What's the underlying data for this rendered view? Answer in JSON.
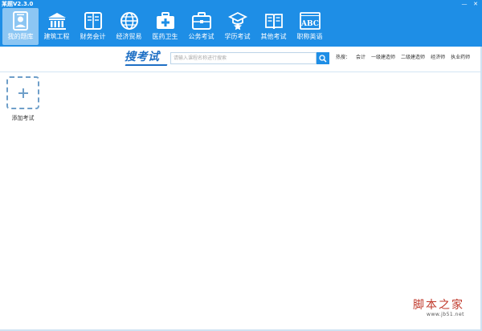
{
  "window": {
    "title": "某题V2.3.0",
    "minimize": "—",
    "close": "✕"
  },
  "nav": {
    "items": [
      {
        "label": "我的题库",
        "icon": "question-bank-icon",
        "active": true
      },
      {
        "label": "建筑工程",
        "icon": "building-icon"
      },
      {
        "label": "财务会计",
        "icon": "book-icon"
      },
      {
        "label": "经济贸易",
        "icon": "globe-icon"
      },
      {
        "label": "医药卫生",
        "icon": "medical-kit-icon"
      },
      {
        "label": "公务考试",
        "icon": "briefcase-icon"
      },
      {
        "label": "学历考试",
        "icon": "graduate-icon"
      },
      {
        "label": "其他考试",
        "icon": "open-book-icon"
      },
      {
        "label": "职称英语",
        "icon": "abc-icon"
      }
    ]
  },
  "search": {
    "logo": "搜考试",
    "placeholder": "请输入课程名称进行搜索",
    "hot_label": "热搜：",
    "hot_links": [
      "会计",
      "一级建造师",
      "二级建造师",
      "经济师",
      "执业药师"
    ]
  },
  "content": {
    "add_label": "添加考试"
  },
  "watermark": {
    "title": "脚本之家",
    "url": "www.jb51.net"
  },
  "colors": {
    "brand": "#1e8ee6",
    "active_tab": "#8cc6f3",
    "logo": "#1e6fc4",
    "watermark": "#c0392b"
  }
}
